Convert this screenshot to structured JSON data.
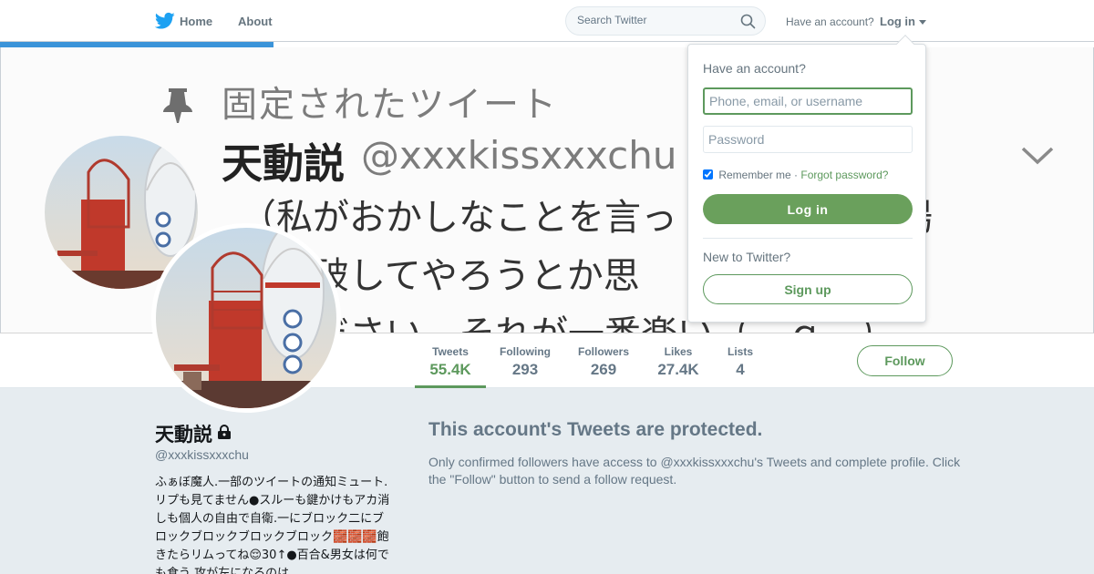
{
  "nav": {
    "home_label": "Home",
    "about_label": "About",
    "search_placeholder": "Search Twitter",
    "have_account_text": "Have an account?",
    "login_label": "Log in"
  },
  "banner": {
    "pinned_label": "固定されたツイート",
    "name": "天動説",
    "handle": "@xxxkissxxxchu",
    "text_lines": [
      "（私がおかしなことを言っ　　　　じる場",
      "　論破してやろうとか思　　　　に聞い",
      "　ください。それが一番楽い（＾ｑ＾）"
    ]
  },
  "header_progress": 0.25,
  "profile_nav": {
    "stats": [
      {
        "label": "Tweets",
        "value": "55.4K"
      },
      {
        "label": "Following",
        "value": "293"
      },
      {
        "label": "Followers",
        "value": "269"
      },
      {
        "label": "Likes",
        "value": "27.4K"
      },
      {
        "label": "Lists",
        "value": "4"
      }
    ],
    "active_tab": "Tweets",
    "follow_label": "Follow"
  },
  "profile": {
    "name": "天動説",
    "handle": "@xxxkissxxxchu",
    "bio": "ふぁぼ魔人.一部のツイートの通知ミュート.リプも見てません●スルーも鍵かけもアカ消しも個人の自由で自衛.一にブロック二にブロックブロックブロックブロック🧱🧱🧱飽きたらリムってね😌30↑●百合&男女は何でも食う.攻が左になるのは"
  },
  "protected": {
    "title": "This account's Tweets are protected.",
    "body": "Only confirmed followers have access to @xxxkissxxxchu's Tweets and complete profile. Click the \"Follow\" button to send a follow request."
  },
  "login_dropdown": {
    "title": "Have an account?",
    "username_placeholder": "Phone, email, or username",
    "password_placeholder": "Password",
    "remember_label": "Remember me",
    "separator": " · ",
    "forgot_label": "Forgot password?",
    "remember_checked": true,
    "login_button": "Log in",
    "new_text": "New to Twitter?",
    "signup_button": "Sign up"
  },
  "colors": {
    "accent": "#5d995d",
    "twitter_blue": "#1da1f2",
    "muted_text": "#657786"
  },
  "icons": {
    "logo": "twitter-bird-icon",
    "search": "search-icon",
    "pin": "pin-icon",
    "chevron": "chevron-down-icon",
    "lock": "lock-icon",
    "caret": "caret-down-icon"
  }
}
